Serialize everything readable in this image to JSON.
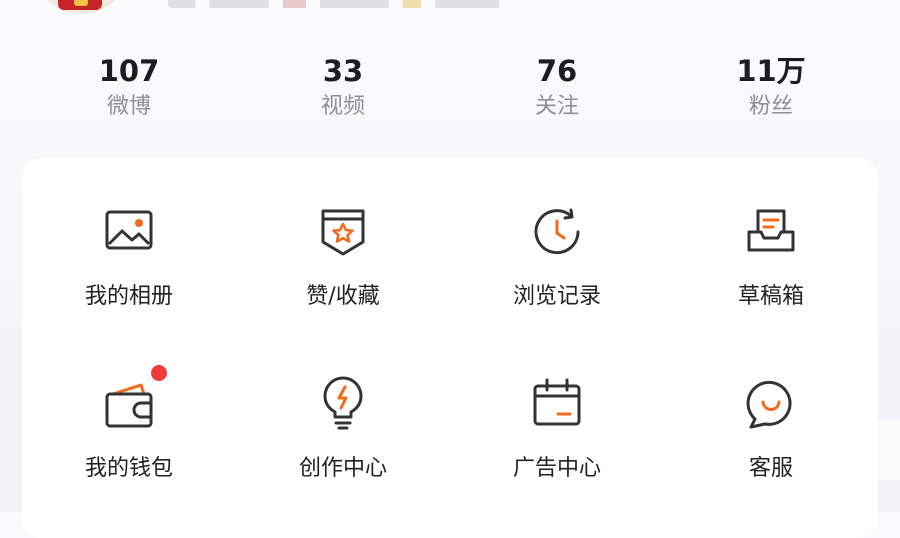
{
  "stats": [
    {
      "value": "107",
      "label": "微博"
    },
    {
      "value": "33",
      "label": "视频"
    },
    {
      "value": "76",
      "label": "关注"
    },
    {
      "value": "11万",
      "label": "粉丝"
    }
  ],
  "menu": {
    "row1": [
      {
        "label": "我的相册",
        "icon": "photo-album-icon"
      },
      {
        "label": "赞/收藏",
        "icon": "star-bookmark-icon"
      },
      {
        "label": "浏览记录",
        "icon": "history-clock-icon"
      },
      {
        "label": "草稿箱",
        "icon": "draft-box-icon"
      }
    ],
    "row2": [
      {
        "label": "我的钱包",
        "icon": "wallet-icon"
      },
      {
        "label": "创作中心",
        "icon": "lightbulb-icon"
      },
      {
        "label": "广告中心",
        "icon": "calendar-ad-icon"
      },
      {
        "label": "客服",
        "icon": "chat-smile-icon"
      }
    ]
  },
  "colors": {
    "accent": "#f26b1d",
    "icon_stroke": "#333333",
    "badge": "#f23b3b"
  }
}
